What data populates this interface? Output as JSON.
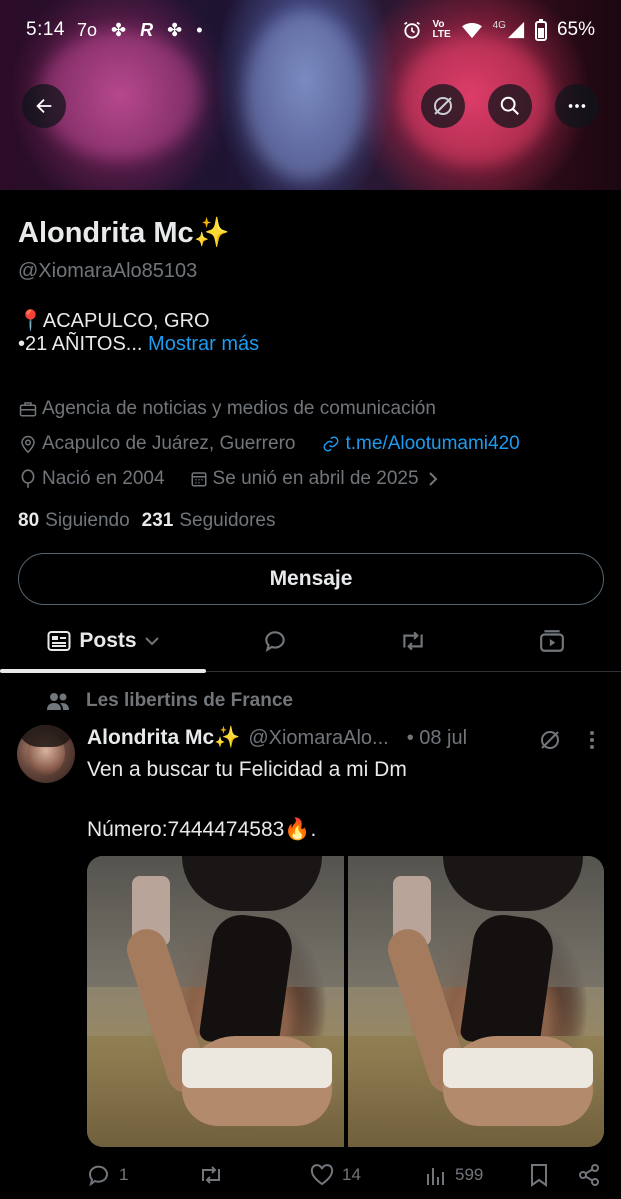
{
  "status_bar": {
    "time": "5:14",
    "left_icons": [
      "7o",
      "✤",
      "R",
      "✤",
      "•"
    ],
    "network_vo": "Vo",
    "network_lte": "LTE",
    "network_4g": "4G",
    "battery": "65%"
  },
  "header": {
    "back_icon": "arrow-left-icon",
    "grok_icon": "grok-icon",
    "search_icon": "search-icon",
    "more_icon": "more-icon"
  },
  "profile": {
    "name": "Alondrita Mc✨",
    "handle": "@XiomaraAlo85103",
    "bio_line1": "📍ACAPULCO, GRO",
    "bio_line2": "•21 AÑITOS...",
    "show_more": "Mostrar más",
    "category": "Agencia de noticias y medios de comunicación",
    "location": "Acapulco de Juárez, Guerrero",
    "website": "t.me/Alootumami420",
    "born": "Nació en 2004",
    "joined": "Se unió en abril de 2025",
    "following_count": "80",
    "following_label": "Siguiendo",
    "followers_count": "231",
    "followers_label": "Seguidores",
    "message_button": "Mensaje"
  },
  "tabs": {
    "posts_label": "Posts"
  },
  "post": {
    "community": "Les libertins de France",
    "author": "Alondrita Mc✨",
    "handle": "@XiomaraAlo...",
    "date": "• 08 jul",
    "text_line1": "Ven a buscar tu Felicidad a mi Dm",
    "text_line2": "Número:7444474583🔥.",
    "replies": "1",
    "likes": "14",
    "views": "599"
  },
  "colors": {
    "background": "#000000",
    "text_primary": "#e7e9ea",
    "text_secondary": "#71767b",
    "accent": "#1d9bf0",
    "border": "#2f3336"
  }
}
